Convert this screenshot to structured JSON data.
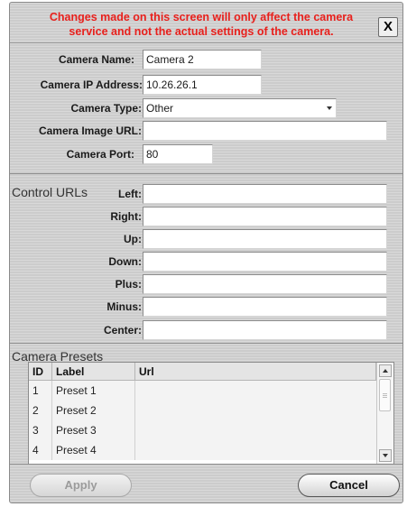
{
  "header": {
    "warning": "Changes made on this screen will only affect the camera service and not the actual settings of the camera.",
    "close_label": "X",
    "warning_color": "#e8201c"
  },
  "camera": {
    "name_label": "Camera Name:",
    "name_value": "Camera 2",
    "ip_label": "Camera IP Address:",
    "ip_value": "10.26.26.1",
    "type_label": "Camera Type:",
    "type_value": "Other",
    "image_url_label": "Camera Image URL:",
    "image_url_value": "",
    "port_label": "Camera Port:",
    "port_value": "80"
  },
  "control_urls": {
    "title": "Control URLs",
    "fields": [
      {
        "label": "Left:",
        "value": ""
      },
      {
        "label": "Right:",
        "value": ""
      },
      {
        "label": "Up:",
        "value": ""
      },
      {
        "label": "Down:",
        "value": ""
      },
      {
        "label": "Plus:",
        "value": ""
      },
      {
        "label": "Minus:",
        "value": ""
      },
      {
        "label": "Center:",
        "value": ""
      }
    ]
  },
  "presets": {
    "title": "Camera Presets",
    "columns": [
      "ID",
      "Label",
      "Url"
    ],
    "rows": [
      {
        "id": "1",
        "label": "Preset 1",
        "url": ""
      },
      {
        "id": "2",
        "label": "Preset 2",
        "url": ""
      },
      {
        "id": "3",
        "label": "Preset 3",
        "url": ""
      },
      {
        "id": "4",
        "label": "Preset 4",
        "url": ""
      }
    ]
  },
  "buttons": {
    "apply_label": "Apply",
    "cancel_label": "Cancel"
  },
  "icons": {
    "close": "close-icon",
    "dropdown": "chevron-down-icon",
    "scroll_up": "scroll-up-arrow-icon",
    "scroll_down": "scroll-down-arrow-icon"
  }
}
